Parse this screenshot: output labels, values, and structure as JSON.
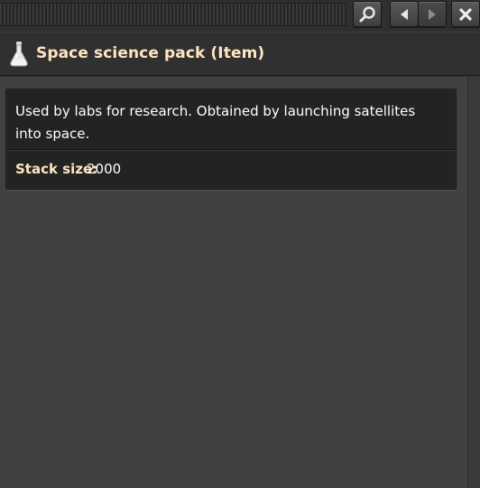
{
  "titlebar": {
    "search_icon": "magnifier-icon",
    "back_icon": "triangle-left-icon",
    "forward_icon": "triangle-right-icon",
    "close_icon": "x-close-icon"
  },
  "header": {
    "icon": "space-science-pack-flask-icon",
    "title": "Space science pack (Item)"
  },
  "item": {
    "description": "Used by labs for research. Obtained by launching satellites into space.",
    "stack_size_label": "Stack size:",
    "stack_size_value": "2000"
  },
  "colors": {
    "title": "#ffe6c0",
    "panel_bg": "#414141",
    "frame_bg": "#313031",
    "box_bg": "#232323",
    "text": "#ffffff"
  }
}
